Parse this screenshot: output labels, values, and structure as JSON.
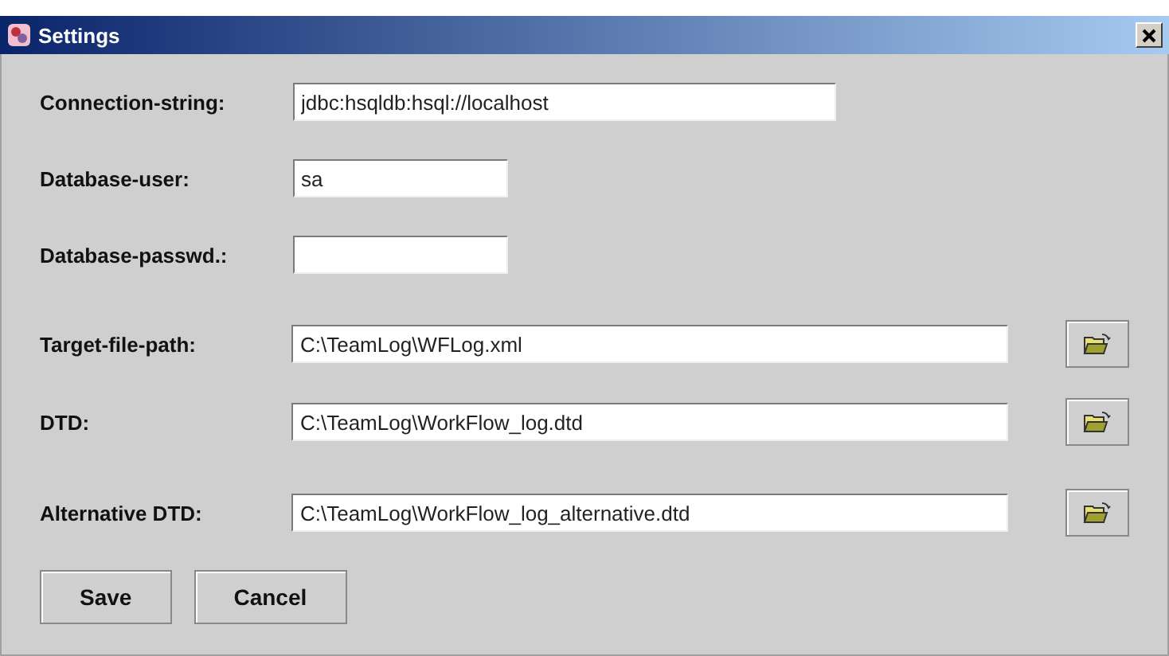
{
  "window": {
    "title": "Settings"
  },
  "fields": [
    {
      "label": "Connection-string:",
      "value": "jdbc:hsqldb:hsql://localhost",
      "kind": "medium"
    },
    {
      "label": "Database-user:",
      "value": "sa",
      "kind": "short"
    },
    {
      "label": "Database-passwd.:",
      "kind": "short"
    },
    {
      "label": "Target-file-path:",
      "value": "C:\\TeamLog\\WFLog.xml",
      "kind": "path"
    },
    {
      "label": "DTD:",
      "value": "C:\\TeamLog\\WorkFlow_log.dtd",
      "kind": "path"
    },
    {
      "label": "Alternative DTD:",
      "value": "C:\\TeamLog\\WorkFlow_log_alternative.dtd",
      "kind": "path"
    }
  ],
  "buttons": [
    "Save",
    "Cancel"
  ]
}
